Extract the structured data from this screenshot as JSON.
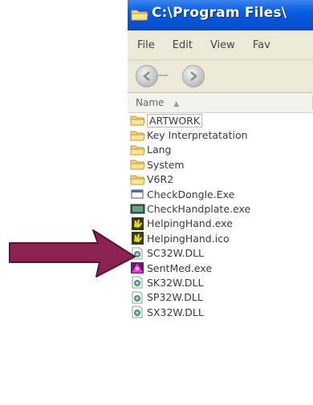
{
  "window": {
    "title": "C:\\Program Files\\"
  },
  "menu": {
    "file": "File",
    "edit": "Edit",
    "view": "View",
    "favorites": "Fav"
  },
  "columns": {
    "name": "Name"
  },
  "files": [
    {
      "name": "ARTWORK",
      "icon": "folder-icon"
    },
    {
      "name": "Key Interpretatation",
      "icon": "folder-icon"
    },
    {
      "name": "Lang",
      "icon": "folder-icon"
    },
    {
      "name": "System",
      "icon": "folder-icon"
    },
    {
      "name": "V6R2",
      "icon": "folder-icon"
    },
    {
      "name": "CheckDongle.Exe",
      "icon": "window-app-icon"
    },
    {
      "name": "CheckHandplate.exe",
      "icon": "monitor-app-icon"
    },
    {
      "name": "HelpingHand.exe",
      "icon": "helpinghand-icon"
    },
    {
      "name": "HelpingHand.ico",
      "icon": "helpinghand-icon"
    },
    {
      "name": "SC32W.DLL",
      "icon": "dll-icon"
    },
    {
      "name": "SentMed.exe",
      "icon": "sentmed-icon"
    },
    {
      "name": "SK32W.DLL",
      "icon": "dll-icon"
    },
    {
      "name": "SP32W.DLL",
      "icon": "dll-icon"
    },
    {
      "name": "SX32W.DLL",
      "icon": "dll-icon"
    }
  ],
  "colors": {
    "titlebar": "#0553d6",
    "arrow": "#8b2252",
    "chrome": "#ece9d8"
  }
}
